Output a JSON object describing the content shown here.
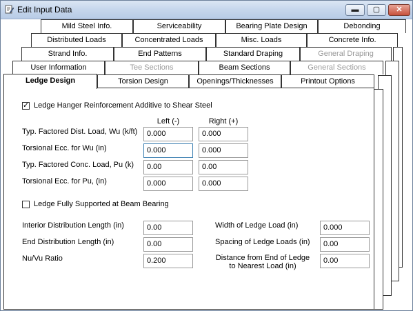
{
  "window": {
    "title": "Edit Input Data"
  },
  "tab_rows": [
    [
      "Mild Steel Info.",
      "Serviceability",
      "Bearing Plate Design",
      "Debonding"
    ],
    [
      "Distributed Loads",
      "Concentrated Loads",
      "Misc. Loads",
      "Concrete Info."
    ],
    [
      "Strand Info.",
      "End Patterns",
      "Standard Draping",
      "General Draping"
    ],
    [
      "User Information",
      "Tee Sections",
      "Beam Sections",
      "General Sections"
    ],
    [
      "Ledge Design",
      "Torsion Design",
      "Openings/Thicknesses",
      "Printout Options"
    ]
  ],
  "disabled_tabs": [
    "General Draping",
    "Tee Sections",
    "General Sections"
  ],
  "active_tab": "Ledge Design",
  "ledge": {
    "hanger_checkbox": {
      "label": "Ledge Hanger Reinforcement Additive to Shear Steel",
      "checked": true
    },
    "col_left": "Left (-)",
    "col_right": "Right (+)",
    "rows": [
      {
        "label": "Typ. Factored Dist. Load, Wu (k/ft)",
        "left": "0.000",
        "right": "0.000"
      },
      {
        "label": "Torsional Ecc. for Wu (in)",
        "left": "0.000",
        "right": "0.000"
      },
      {
        "label": "Typ. Factored Conc. Load, Pu (k)",
        "left": "0.00",
        "right": "0.00"
      },
      {
        "label": "Torsional Ecc. for Pu, (in)",
        "left": "0.000",
        "right": "0.000"
      }
    ],
    "supported_checkbox": {
      "label": "Ledge Fully Supported at Beam Bearing",
      "checked": false
    },
    "left_fields": [
      {
        "label": "Interior Distribution Length (in)",
        "value": "0.00"
      },
      {
        "label": "End Distribution Length (in)",
        "value": "0.00"
      },
      {
        "label": "Nu/Vu Ratio",
        "value": "0.200"
      }
    ],
    "right_fields": [
      {
        "label": "Width of Ledge Load (in)",
        "value": "0.000"
      },
      {
        "label": "Spacing of Ledge Loads (in)",
        "value": "0.00"
      },
      {
        "label": "Distance from End of Ledge",
        "label2": "to Nearest Load (in)",
        "value": "0.00"
      }
    ]
  }
}
